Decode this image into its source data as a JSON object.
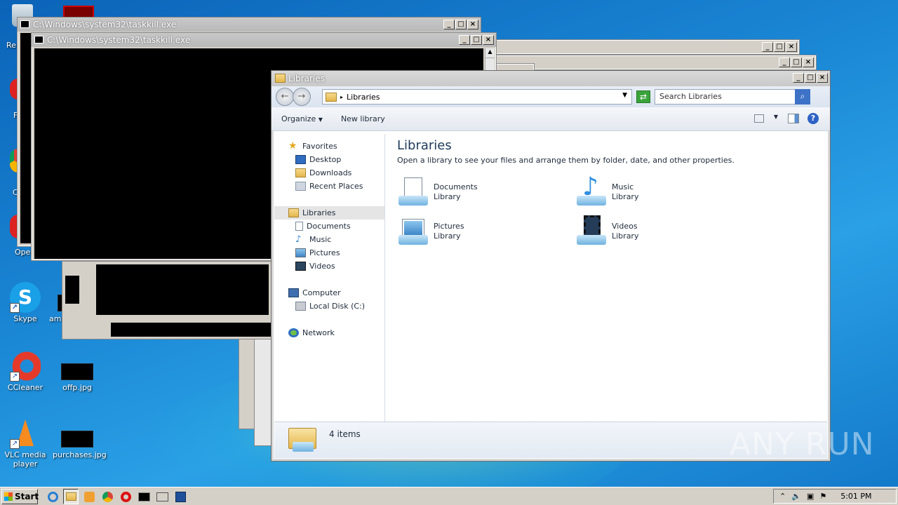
{
  "desktop": {
    "icons": [
      {
        "label": "Skype",
        "icon": "skype-icon"
      },
      {
        "label": "americanpic...",
        "icon": "image-file-icon"
      },
      {
        "label": "CCleaner",
        "icon": "ccleaner-icon"
      },
      {
        "label": "offp.jpg",
        "icon": "image-file-icon"
      },
      {
        "label": "VLC media player",
        "icon": "vlc-icon"
      },
      {
        "label": "purchases.jpg",
        "icon": "image-file-icon"
      }
    ],
    "partial_labels": {
      "re": "Re",
      "open": "Oper",
      "f": "F",
      "c": "C"
    }
  },
  "cmd_windows": [
    {
      "title": "C:\\Windows\\system32\\taskkill.exe"
    },
    {
      "title": "C:\\Windows\\system32\\taskkill.exe"
    }
  ],
  "explorer": {
    "title": "Libraries",
    "address": "Libraries",
    "search_placeholder": "Search Libraries",
    "toolbar": {
      "organize": "Organize",
      "new_library": "New library"
    },
    "nav": {
      "favorites": "Favorites",
      "favorites_items": [
        "Desktop",
        "Downloads",
        "Recent Places"
      ],
      "libraries": "Libraries",
      "libraries_items": [
        "Documents",
        "Music",
        "Pictures",
        "Videos"
      ],
      "computer": "Computer",
      "computer_items": [
        "Local Disk (C:)"
      ],
      "network": "Network"
    },
    "heading": "Libraries",
    "description": "Open a library to see your files and arrange them by folder, date, and other properties.",
    "libraries": [
      {
        "name": "Documents",
        "type": "Library"
      },
      {
        "name": "Music",
        "type": "Library"
      },
      {
        "name": "Pictures",
        "type": "Library"
      },
      {
        "name": "Videos",
        "type": "Library"
      }
    ],
    "status": "4 items"
  },
  "taskbar": {
    "start": "Start",
    "clock": "5:01 PM"
  },
  "watermark": "ANY RUN"
}
